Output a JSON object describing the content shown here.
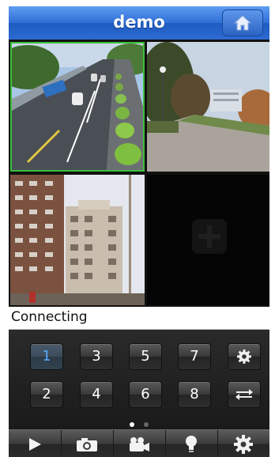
{
  "header": {
    "title": "demo",
    "home_icon": "home-icon"
  },
  "status": {
    "text": "Connecting"
  },
  "channels": {
    "row1": [
      "1",
      "3",
      "5",
      "7"
    ],
    "row2": [
      "2",
      "4",
      "6",
      "8"
    ],
    "selected": "1",
    "side_icons": [
      "gear-icon",
      "swap-icon"
    ]
  },
  "pager": {
    "pages": 2,
    "current": 1
  },
  "toolbar": {
    "icons": [
      "play-icon",
      "camera-icon",
      "video-camera-icon",
      "bulb-icon",
      "settings-icon"
    ]
  },
  "colors": {
    "header": "#2f6fd6",
    "selected_border": "#3cbf3c",
    "selected_button_text": "#55aaff"
  }
}
